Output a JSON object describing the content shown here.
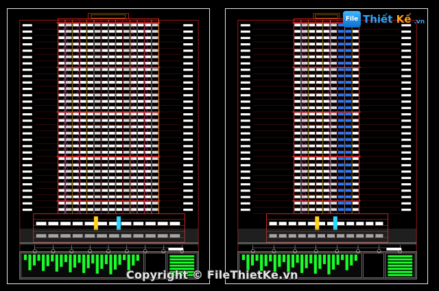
{
  "sheets": [
    {
      "id": "left",
      "view": "front-elevation"
    },
    {
      "id": "right",
      "view": "side-elevation"
    }
  ],
  "floor_count": 30,
  "colors": {
    "background": "#000000",
    "border": "#e8e8e8",
    "facade_lines": "#ff2a2a",
    "window_white": "#ffffff",
    "yellow_trim": "#ffd21c",
    "green_block": "#19ff2a",
    "blue_glass": "#2f7bff",
    "magenta_trim": "#ff35ff",
    "cyan_dim": "#29d7ff"
  },
  "watermark": {
    "logo_badge": "File",
    "logo_word1": "Thiết",
    "logo_word2": "Kế",
    "logo_domain": ".vn",
    "copyright": "Copyright © FileThietKe.vn"
  }
}
